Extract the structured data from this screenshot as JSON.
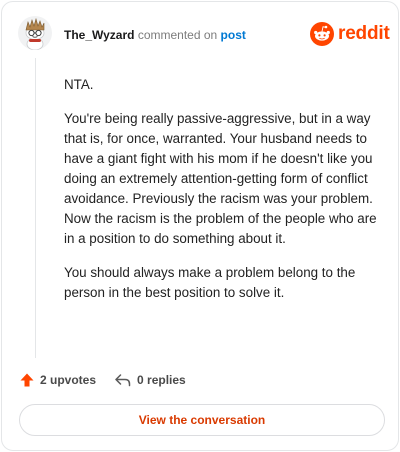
{
  "header": {
    "username": "The_Wyzard",
    "action_text": "commented on",
    "post_link": "post",
    "logo_text": "reddit"
  },
  "comment": {
    "paragraphs": [
      "NTA.",
      "You're being really passive-aggressive, but in a way that is, for once, warranted. Your husband needs to have a giant fight with his mom if he doesn't like you doing an extremely attention-getting form of conflict avoidance. Previously the racism was your problem. Now the racism is the problem of the people who are in a position to do something about it.",
      "You should always make a problem belong to the person in the best position to solve it."
    ]
  },
  "footer": {
    "upvotes_label": "2 upvotes",
    "replies_label": "0 replies",
    "view_button_label": "View the conversation"
  },
  "colors": {
    "brand": "#ff4500",
    "link": "#0079d3",
    "button_text": "#d93a00"
  },
  "icons": {
    "avatar": "snoo-avatar-icon",
    "logo": "reddit-snoo-icon",
    "upvote": "upvote-arrow-icon",
    "reply": "reply-arrow-icon"
  }
}
